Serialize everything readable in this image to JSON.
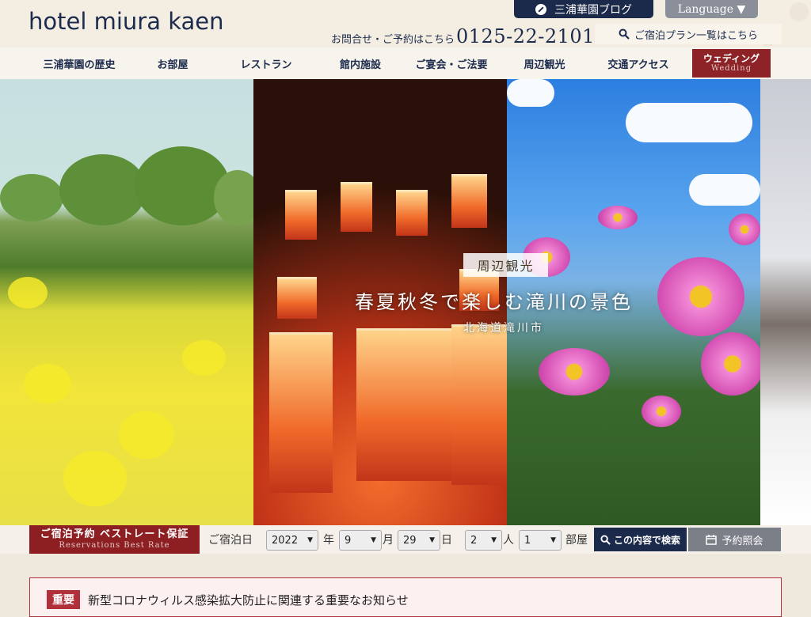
{
  "header": {
    "logo": "hotel miura kaen",
    "blog_label": "三浦華園ブログ",
    "language_label": "Language ▼",
    "contact_label": "お問合せ・ご予約はこちら",
    "phone": "0125-22-2101",
    "plan_link": "ご宿泊プラン一覧はこちら"
  },
  "nav": {
    "items": [
      "三浦華園の歴史",
      "お部屋",
      "レストラン",
      "館内施設",
      "ご宴会・ご法要",
      "周辺観光",
      "交通アクセス"
    ],
    "wedding_ja": "ウェディング",
    "wedding_en": "Wedding"
  },
  "hero": {
    "tag": "周辺観光",
    "title": "春夏秋冬で楽しむ滝川の景色",
    "subtitle": "北海道滝川市"
  },
  "reservation": {
    "badge_ja": "ご宿泊予約 ベストレート保証",
    "badge_en": "Reservations Best Rate",
    "checkin_label": "ご宿泊日",
    "year": "2022",
    "year_unit": "年",
    "month": "9",
    "month_unit": "月",
    "day": "29",
    "day_unit": "日",
    "people": "2",
    "people_unit": "人",
    "rooms": "1",
    "rooms_unit": "部屋",
    "search_label": "この内容で検索",
    "inquiry_label": "予約照会"
  },
  "notice": {
    "tag": "重要",
    "text": "新型コロナウィルス感染拡大防止に関連する重要なお知らせ"
  },
  "colors": {
    "navy": "#1b2a4a",
    "wine": "#8d1f23",
    "gray_button": "#7b7f88"
  }
}
